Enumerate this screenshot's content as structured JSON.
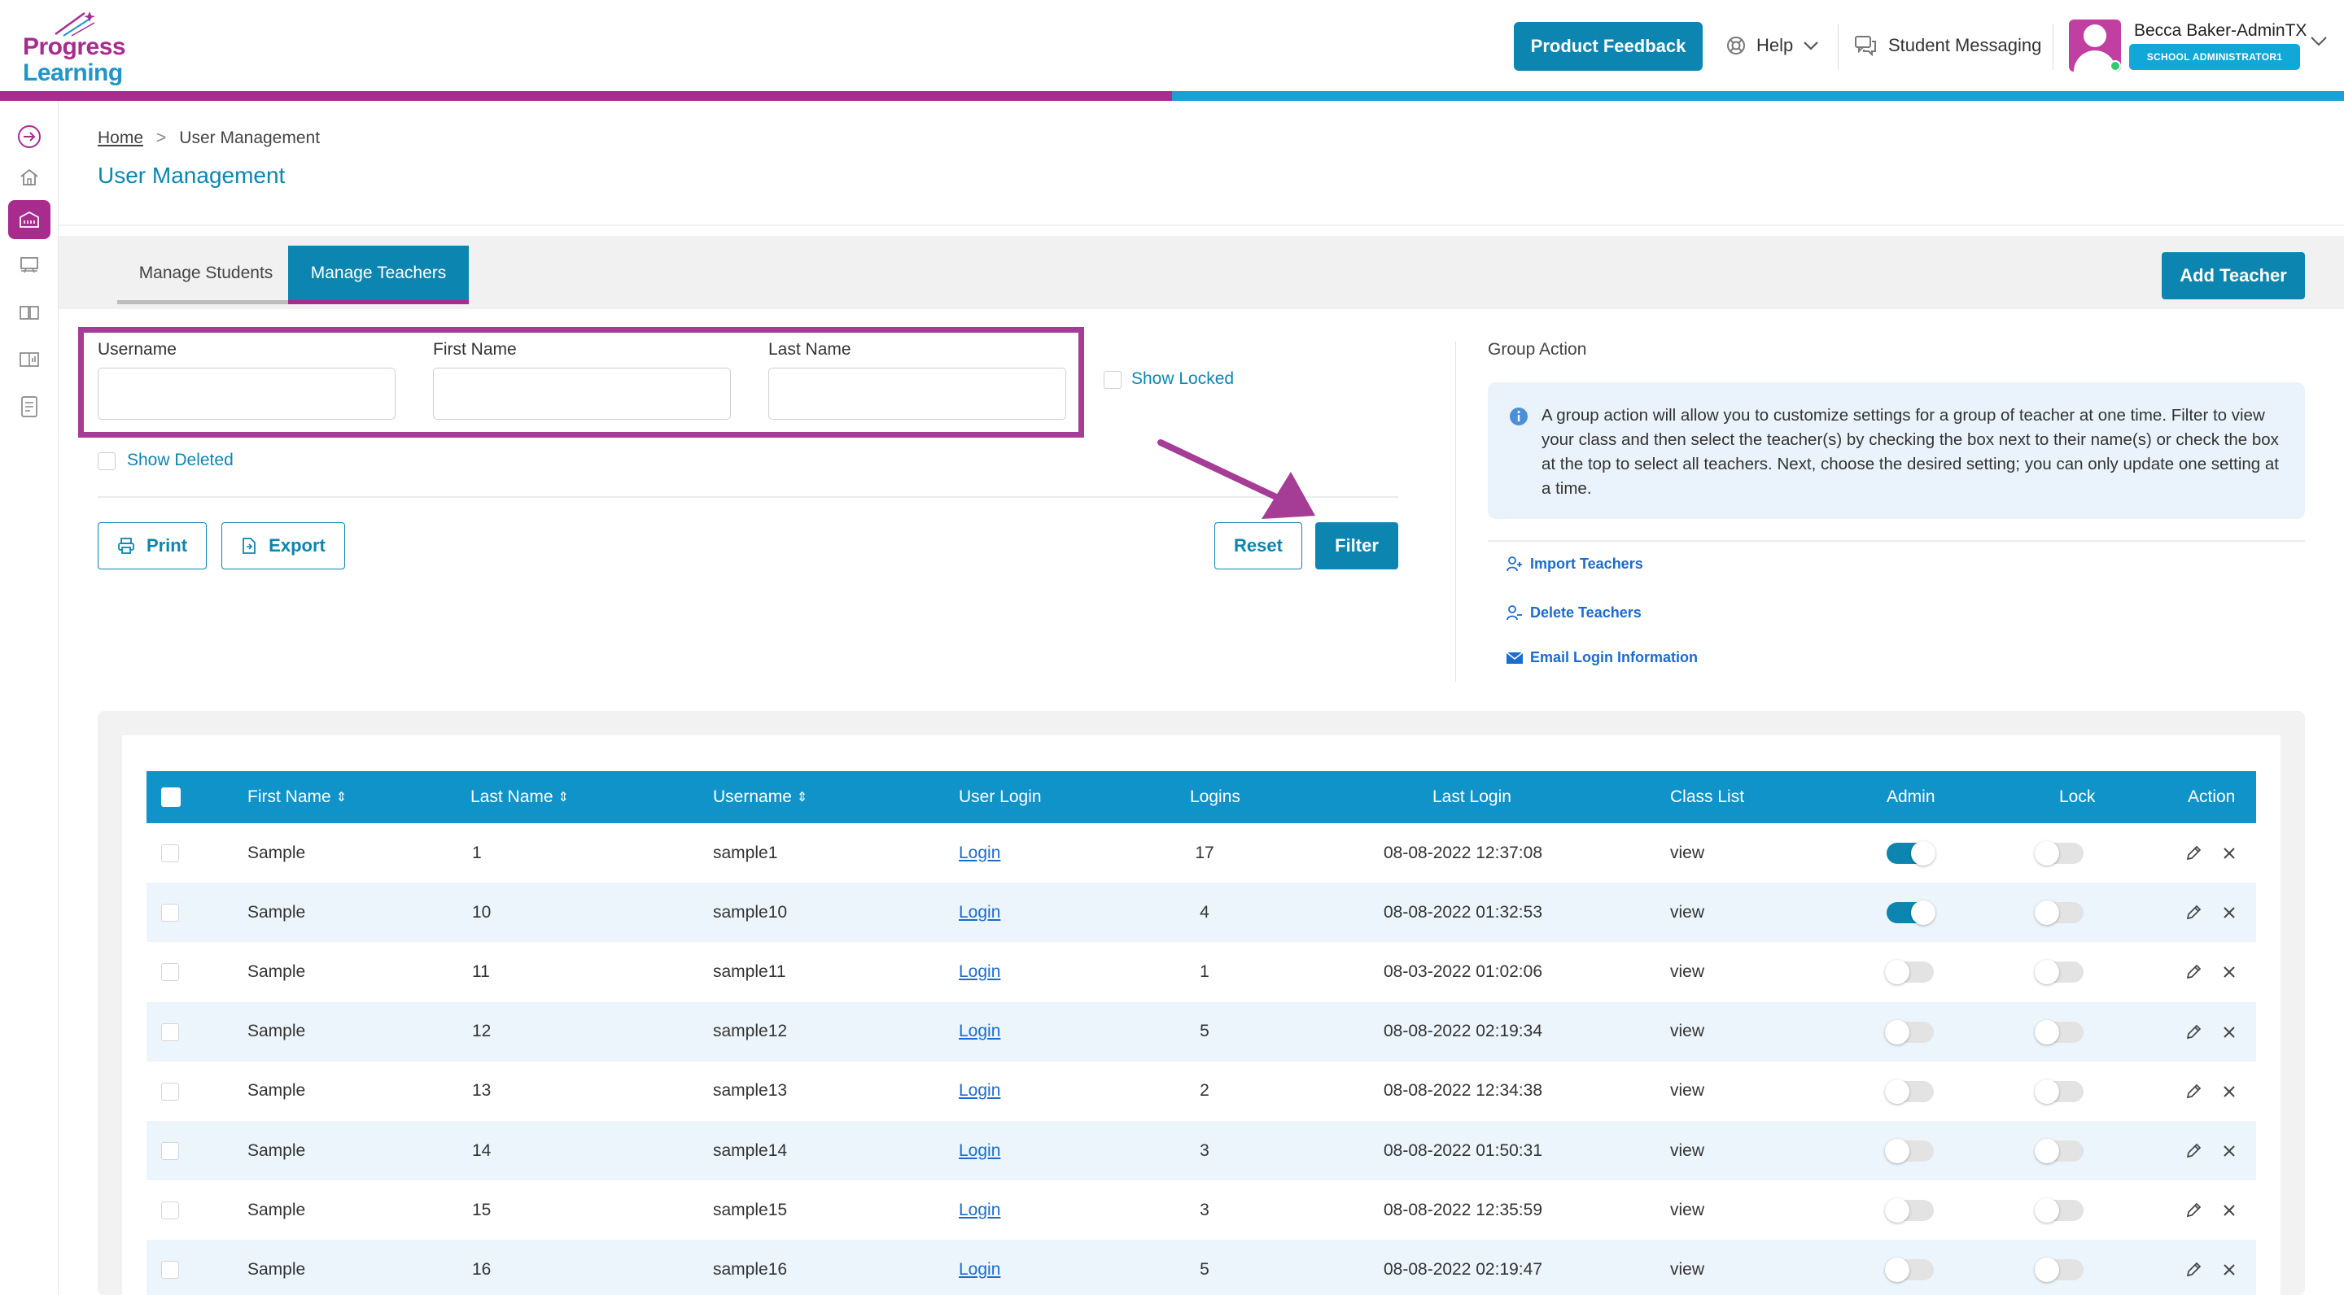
{
  "header": {
    "logo_line1": "Progress",
    "logo_line2": "Learning",
    "feedback_label": "Product Feedback",
    "help_label": "Help",
    "messaging_label": "Student Messaging",
    "user_name": "Becca Baker-AdminTX",
    "user_role": "SCHOOL ADMINISTRATOR1"
  },
  "breadcrumb": {
    "home": "Home",
    "sep": ">",
    "current": "User Management"
  },
  "page_title": "User Management",
  "tabs": {
    "students": "Manage Students",
    "teachers": "Manage Teachers"
  },
  "add_teacher_label": "Add Teacher",
  "filters": {
    "username_label": "Username",
    "firstname_label": "First Name",
    "lastname_label": "Last Name",
    "username_value": "",
    "firstname_value": "",
    "lastname_value": "",
    "show_locked": "Show Locked",
    "show_deleted": "Show Deleted"
  },
  "buttons": {
    "print": "Print",
    "export": "Export",
    "reset": "Reset",
    "filter": "Filter"
  },
  "group_action": {
    "title": "Group Action",
    "info": "A group action will allow you to customize settings for a group of teacher at one time. Filter to view your class and then select the teacher(s) by checking the box next to their name(s) or check the box at the top to select all teachers. Next, choose the desired setting; you can only update one setting at a time.",
    "import": "Import Teachers",
    "delete": "Delete Teachers",
    "email": "Email Login Information"
  },
  "table": {
    "columns": {
      "first_name": "First Name",
      "last_name": "Last Name",
      "username": "Username",
      "user_login": "User Login",
      "logins": "Logins",
      "last_login": "Last Login",
      "class_list": "Class List",
      "admin": "Admin",
      "lock": "Lock",
      "action": "Action"
    },
    "rows": [
      {
        "first": "Sample",
        "last": "1",
        "username": "sample1",
        "login": "Login",
        "logins": "17",
        "last_login": "08-08-2022 12:37:08",
        "class_list": "view",
        "admin": true,
        "lock": false
      },
      {
        "first": "Sample",
        "last": "10",
        "username": "sample10",
        "login": "Login",
        "logins": "4",
        "last_login": "08-08-2022 01:32:53",
        "class_list": "view",
        "admin": true,
        "lock": false
      },
      {
        "first": "Sample",
        "last": "11",
        "username": "sample11",
        "login": "Login",
        "logins": "1",
        "last_login": "08-03-2022 01:02:06",
        "class_list": "view",
        "admin": false,
        "lock": false
      },
      {
        "first": "Sample",
        "last": "12",
        "username": "sample12",
        "login": "Login",
        "logins": "5",
        "last_login": "08-08-2022 02:19:34",
        "class_list": "view",
        "admin": false,
        "lock": false
      },
      {
        "first": "Sample",
        "last": "13",
        "username": "sample13",
        "login": "Login",
        "logins": "2",
        "last_login": "08-08-2022 12:34:38",
        "class_list": "view",
        "admin": false,
        "lock": false
      },
      {
        "first": "Sample",
        "last": "14",
        "username": "sample14",
        "login": "Login",
        "logins": "3",
        "last_login": "08-08-2022 01:50:31",
        "class_list": "view",
        "admin": false,
        "lock": false
      },
      {
        "first": "Sample",
        "last": "15",
        "username": "sample15",
        "login": "Login",
        "logins": "3",
        "last_login": "08-08-2022 12:35:59",
        "class_list": "view",
        "admin": false,
        "lock": false
      },
      {
        "first": "Sample",
        "last": "16",
        "username": "sample16",
        "login": "Login",
        "logins": "5",
        "last_login": "08-08-2022 02:19:47",
        "class_list": "view",
        "admin": false,
        "lock": false
      }
    ]
  },
  "colors": {
    "primary": "#0c86b0",
    "brand_magenta": "#a82c8e",
    "highlight": "#a53c95",
    "link": "#1a6ccf",
    "row_alt": "#ecf5fc"
  }
}
